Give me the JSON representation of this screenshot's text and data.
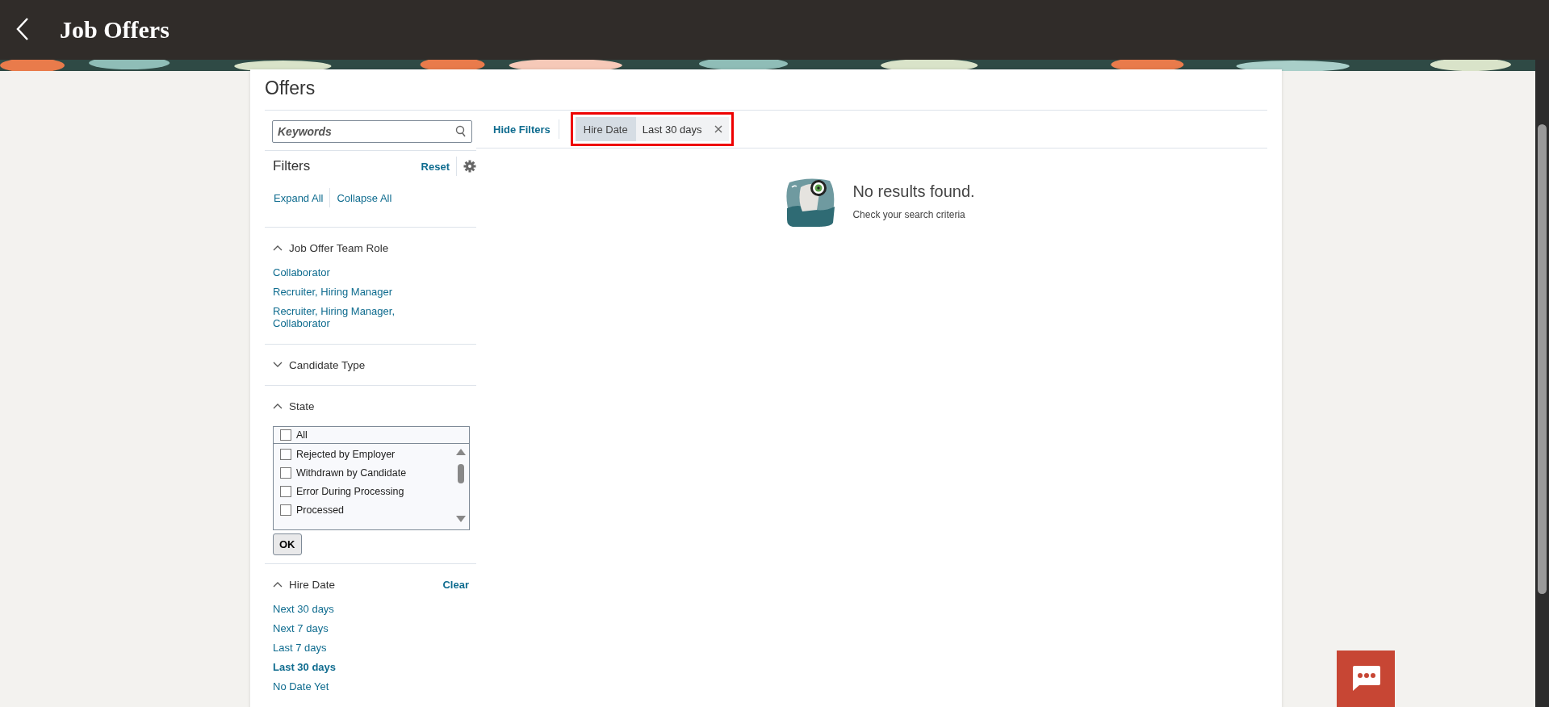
{
  "header": {
    "title": "Job Offers"
  },
  "page": {
    "title": "Offers"
  },
  "search": {
    "placeholder": "Keywords"
  },
  "toolbar": {
    "hide_filters": "Hide Filters",
    "chips": [
      {
        "label": "Hire Date",
        "value": "Last 30 days"
      }
    ]
  },
  "filters": {
    "title": "Filters",
    "reset": "Reset",
    "expand_all": "Expand All",
    "collapse_all": "Collapse All",
    "sections": [
      {
        "kind": "links",
        "title": "Job Offer Team Role",
        "expanded": true,
        "options": [
          {
            "label": "Collaborator",
            "selected": false
          },
          {
            "label": "Recruiter, Hiring Manager",
            "selected": false
          },
          {
            "label": "Recruiter, Hiring Manager, Collaborator",
            "selected": false
          }
        ]
      },
      {
        "title": "Candidate Type",
        "expanded": false
      },
      {
        "kind": "checklist",
        "title": "State",
        "expanded": true,
        "all": {
          "label": "All",
          "checked": false
        },
        "options": [
          {
            "label": "Rejected by Employer",
            "checked": false
          },
          {
            "label": "Withdrawn by Candidate",
            "checked": false
          },
          {
            "label": "Error During Processing",
            "checked": false
          },
          {
            "label": "Processed",
            "checked": false
          }
        ],
        "ok": "OK"
      },
      {
        "kind": "links",
        "title": "Hire Date",
        "expanded": true,
        "clear": "Clear",
        "options": [
          {
            "label": "Next 30 days",
            "selected": false
          },
          {
            "label": "Next 7 days",
            "selected": false
          },
          {
            "label": "Last 7 days",
            "selected": false
          },
          {
            "label": "Last 30 days",
            "selected": true
          },
          {
            "label": "No Date Yet",
            "selected": false
          }
        ]
      }
    ]
  },
  "empty_state": {
    "title": "No results found.",
    "hint": "Check your search criteria"
  }
}
